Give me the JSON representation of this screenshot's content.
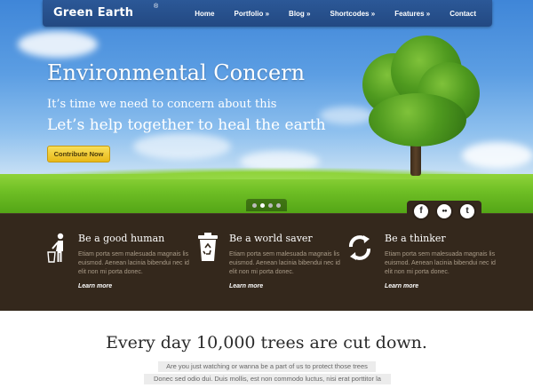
{
  "brand": {
    "logo_text": "Green Earth",
    "reg_mark": "®"
  },
  "nav": {
    "items": [
      {
        "label": "Home"
      },
      {
        "label": "Portfolio »"
      },
      {
        "label": "Blog »"
      },
      {
        "label": "Shortcodes »"
      },
      {
        "label": "Features »"
      },
      {
        "label": "Contact"
      }
    ]
  },
  "hero": {
    "title": "Environmental Concern",
    "subtitle_line1": "It’s time we need to concern about this",
    "subtitle_line2": "Let’s help together to heal the earth",
    "cta_label": "Contribute Now",
    "slider": {
      "slide_count": 4,
      "active_index": 1
    }
  },
  "social": [
    {
      "icon": "facebook-icon",
      "glyph": "f"
    },
    {
      "icon": "flickr-icon",
      "glyph": "●●"
    },
    {
      "icon": "twitter-icon",
      "glyph": "t"
    }
  ],
  "features": [
    {
      "icon": "person-trash-icon",
      "title": "Be a good human",
      "text": "Etiam porta sem malesuada magnais lis euismod. Aenean lacinia bibendui nec id elit non mi porta donec.",
      "more": "Learn more"
    },
    {
      "icon": "recycle-bin-icon",
      "title": "Be a world saver",
      "text": "Etiam porta sem malesuada magnais lis euismod. Aenean lacinia bibendui nec id elit non mi porta donec.",
      "more": "Learn more"
    },
    {
      "icon": "refresh-arrows-icon",
      "title": "Be a thinker",
      "text": "Etiam porta sem malesuada magnais lis euismod. Aenean lacinia bibendui nec id elit non mi porta donec.",
      "more": "Learn more"
    }
  ],
  "bottom": {
    "title": "Every day 10,000 trees are cut down.",
    "line1": "Are you just watching or wanna be a part of us to protect those trees",
    "line2": "Donec sed odio dui. Duis mollis, est non commodo luctus, nisi erat porttitor la"
  },
  "colors": {
    "accent_yellow": "#f0c93a",
    "band_brown": "#34281c",
    "nav_blue": "#2b5590",
    "grass_green": "#6fbf25"
  }
}
